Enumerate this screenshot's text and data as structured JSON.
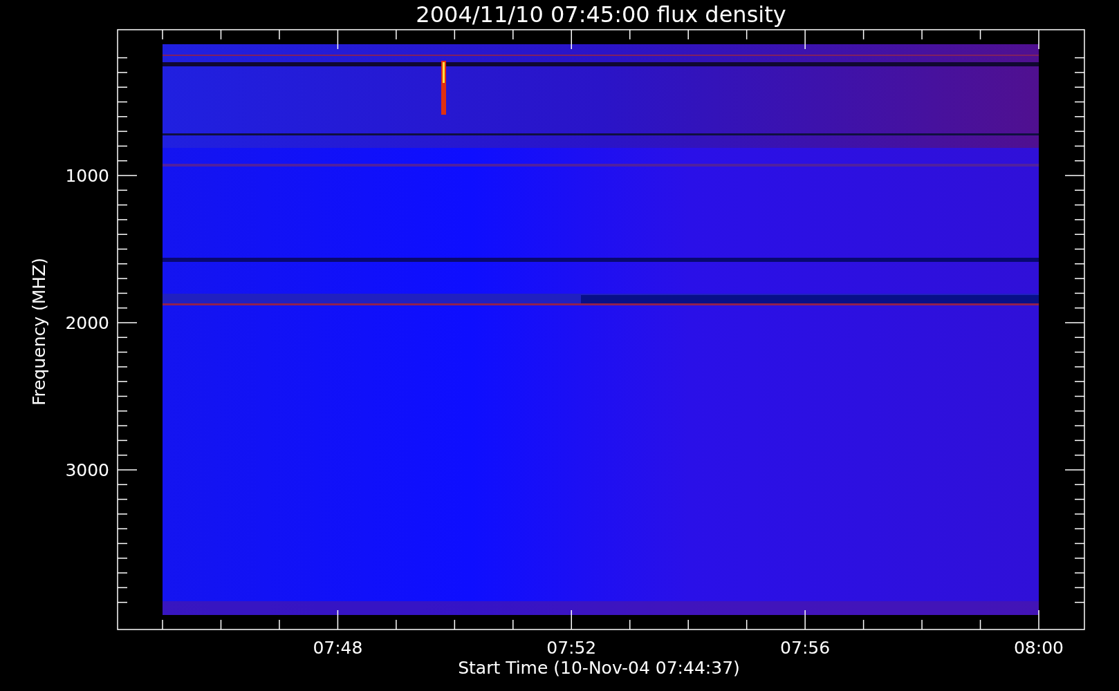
{
  "title": "2004/11/10 07:45:00 flux density",
  "y_axis": {
    "label": "Frequency (MHZ)",
    "tick_labels": [
      "1000",
      "2000",
      "3000"
    ]
  },
  "x_axis": {
    "label": "Start Time (10-Nov-04 07:44:37)",
    "tick_labels": [
      "07:48",
      "07:52",
      "07:56",
      "08:00"
    ]
  }
}
